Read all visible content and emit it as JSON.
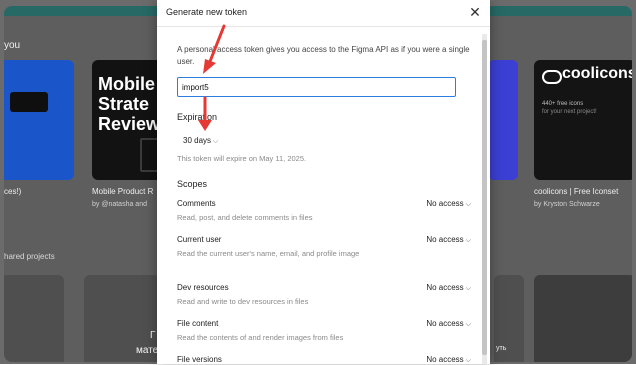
{
  "background": {
    "section_title_top": "you",
    "cards": [
      {
        "title": "Mobile Stratem Review",
        "caption": "Mobile Product R",
        "author": "by @natasha and"
      },
      {
        "title": "coolicons",
        "subtitle1": "440+ free icons",
        "subtitle2": "for your next project!",
        "caption": "coolicons | Free Iconset",
        "author": "by Kryston Schwarze"
      }
    ],
    "left_caption": "ces!)",
    "section_title_bottom": "hared projects",
    "tile_text_1": "Г",
    "tile_text_2": "мате",
    "tile_text_3": "уть"
  },
  "modal": {
    "title": "Generate new token",
    "close_label": "✕",
    "description": "A personal access token gives you access to the Figma API as if you were a single user.",
    "token_input": {
      "value": "import5",
      "placeholder": ""
    },
    "expiration": {
      "label": "Expiration",
      "selected": "30 days",
      "note": "This token will expire on May 11, 2025."
    },
    "scopes_title": "Scopes",
    "scopes": [
      {
        "name": "Comments",
        "description": "Read, post, and delete comments in files",
        "access": "No access"
      },
      {
        "name": "Current user",
        "description": "Read the current user's name, email, and profile image",
        "access": "No access"
      },
      {
        "name": "Dev resources",
        "description": "Read and write to dev resources in files",
        "access": "No access"
      },
      {
        "name": "File content",
        "description": "Read the contents of and render images from files",
        "access": "No access"
      },
      {
        "name": "File versions",
        "description": "",
        "access": "No access"
      }
    ]
  },
  "icons": {
    "close": "close-icon",
    "chevron": "chevron-down-icon",
    "annotation_arrow": "red-arrow-annotation"
  },
  "colors": {
    "accent": "#2d7de1",
    "annotation": "#e53935",
    "overlay": "#5e5e5e",
    "teal_strip": "#1d6b66"
  }
}
